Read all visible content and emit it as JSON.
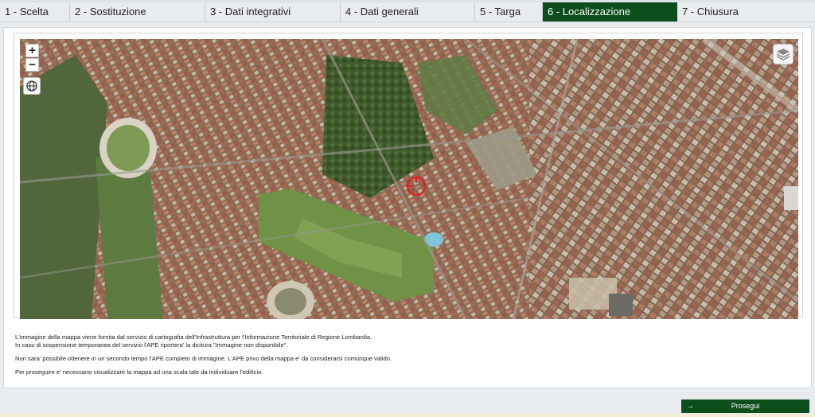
{
  "tabs": [
    {
      "label": "1 - Scelta"
    },
    {
      "label": "2 - Sostituzione"
    },
    {
      "label": "3 - Dati integrativi"
    },
    {
      "label": "4 - Dati generali"
    },
    {
      "label": "5 - Targa"
    },
    {
      "label": "6 - Localizzazione",
      "active": true
    },
    {
      "label": "7 - Chiusura"
    }
  ],
  "map": {
    "zoom_in": "+",
    "zoom_out": "−"
  },
  "info": {
    "line1": "L'immagine della mappa viene fornita dal servizio di cartografia dell'Infrastruttura per l'Informazione Territoriale di Regione Lombardia.",
    "line2": "In caso di sospensione temporanea del servizio l'APE riportera' la dicitura \"Immagine non disponibile\".",
    "line3": "Non sara' possibile ottenere in un secondo tempo l'APE completo di immagine. L'APE privo della mappa e' da considerarsi comunque valido.",
    "line4": "Per proseguire e' necessario visualizzare la mappa ad una scala tale da individuare l'edificio."
  },
  "footer": {
    "next_label": "Prosegui",
    "next_icon": "arrow-right-icon"
  },
  "colors": {
    "accent": "#0e4d1c",
    "marker": "#d7262b"
  }
}
